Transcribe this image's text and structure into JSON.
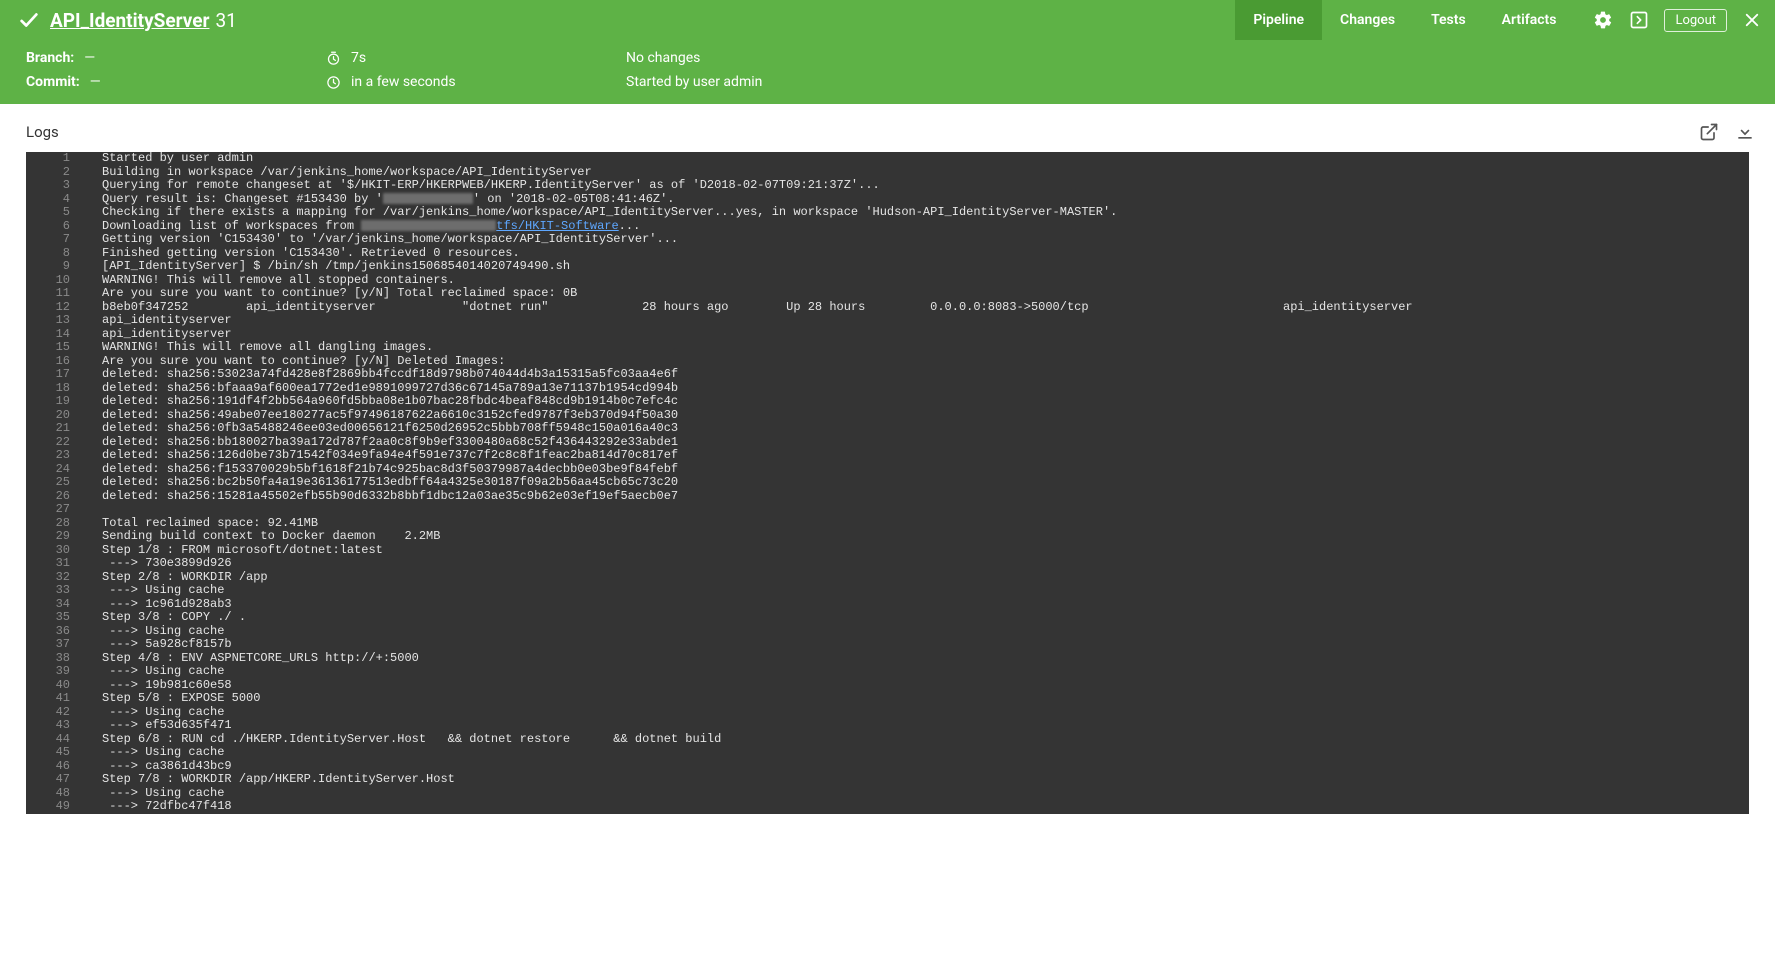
{
  "header": {
    "title_link": "API_IdentityServer",
    "title_number": "31",
    "tabs": [
      {
        "label": "Pipeline",
        "active": true
      },
      {
        "label": "Changes",
        "active": false
      },
      {
        "label": "Tests",
        "active": false
      },
      {
        "label": "Artifacts",
        "active": false
      }
    ],
    "logout_label": "Logout"
  },
  "info": {
    "branch_label": "Branch:",
    "branch_value": "—",
    "commit_label": "Commit:",
    "commit_value": "—",
    "duration": "7s",
    "started": "in a few seconds",
    "changes": "No changes",
    "started_by": "Started by user admin"
  },
  "logs_section": {
    "title": "Logs"
  },
  "log_lines": [
    {
      "n": 1,
      "t": "Started by user admin"
    },
    {
      "n": 2,
      "t": "Building in workspace /var/jenkins_home/workspace/API_IdentityServer"
    },
    {
      "n": 3,
      "t": "Querying for remote changeset at '$/HKIT-ERP/HKERPWEB/HKERP.IdentityServer' as of 'D2018-02-07T09:21:37Z'..."
    },
    {
      "n": 4,
      "segments": [
        {
          "text": "Query result is: Changeset #153430 by '"
        },
        {
          "redact": true
        },
        {
          "text": "' on '2018-02-05T08:41:46Z'."
        }
      ]
    },
    {
      "n": 5,
      "t": "Checking if there exists a mapping for /var/jenkins_home/workspace/API_IdentityServer...yes, in workspace 'Hudson-API_IdentityServer-MASTER'."
    },
    {
      "n": 6,
      "segments": [
        {
          "text": "Downloading list of workspaces from "
        },
        {
          "redact": true,
          "wide": true
        },
        {
          "text": "tfs/HKIT-Software",
          "link": true
        },
        {
          "text": "..."
        }
      ]
    },
    {
      "n": 7,
      "t": "Getting version 'C153430' to '/var/jenkins_home/workspace/API_IdentityServer'..."
    },
    {
      "n": 8,
      "t": "Finished getting version 'C153430'. Retrieved 0 resources."
    },
    {
      "n": 9,
      "t": "[API_IdentityServer] $ /bin/sh /tmp/jenkins1506854014020749490.sh"
    },
    {
      "n": 10,
      "t": "WARNING! This will remove all stopped containers."
    },
    {
      "n": 11,
      "t": "Are you sure you want to continue? [y/N] Total reclaimed space: 0B"
    },
    {
      "n": 12,
      "t": "b8eb0f347252        api_identityserver            \"dotnet run\"             28 hours ago        Up 28 hours         0.0.0.0:8083->5000/tcp                           api_identityserver"
    },
    {
      "n": 13,
      "t": "api_identityserver"
    },
    {
      "n": 14,
      "t": "api_identityserver"
    },
    {
      "n": 15,
      "t": "WARNING! This will remove all dangling images."
    },
    {
      "n": 16,
      "t": "Are you sure you want to continue? [y/N] Deleted Images:"
    },
    {
      "n": 17,
      "t": "deleted: sha256:53023a74fd428e8f2869bb4fccdf18d9798b074044d4b3a15315a5fc03aa4e6f"
    },
    {
      "n": 18,
      "t": "deleted: sha256:bfaaa9af600ea1772ed1e9891099727d36c67145a789a13e71137b1954cd994b"
    },
    {
      "n": 19,
      "t": "deleted: sha256:191df4f2bb564a960fd5bba08e1b07bac28fbdc4beaf848cd9b1914b0c7efc4c"
    },
    {
      "n": 20,
      "t": "deleted: sha256:49abe07ee180277ac5f97496187622a6610c3152cfed9787f3eb370d94f50a30"
    },
    {
      "n": 21,
      "t": "deleted: sha256:0fb3a5488246ee03ed00656121f6250d26952c5bbb708ff5948c150a016a40c3"
    },
    {
      "n": 22,
      "t": "deleted: sha256:bb180027ba39a172d787f2aa0c8f9b9ef3300480a68c52f436443292e33abde1"
    },
    {
      "n": 23,
      "t": "deleted: sha256:126d0be73b71542f034e9fa94e4f591e737c7f2c8c8f1feac2ba814d70c817ef"
    },
    {
      "n": 24,
      "t": "deleted: sha256:f153370029b5bf1618f21b74c925bac8d3f50379987a4decbb0e03be9f84febf"
    },
    {
      "n": 25,
      "t": "deleted: sha256:bc2b50fa4a19e36136177513edbff64a4325e30187f09a2b56aa45cb65c73c20"
    },
    {
      "n": 26,
      "t": "deleted: sha256:15281a45502efb55b90d6332b8bbf1dbc12a03ae35c9b62e03ef19ef5aecb0e7"
    },
    {
      "n": 27,
      "t": ""
    },
    {
      "n": 28,
      "t": "Total reclaimed space: 92.41MB"
    },
    {
      "n": 29,
      "t": "Sending build context to Docker daemon    2.2MB"
    },
    {
      "n": 30,
      "t": "Step 1/8 : FROM microsoft/dotnet:latest"
    },
    {
      "n": 31,
      "t": " ---> 730e3899d926"
    },
    {
      "n": 32,
      "t": "Step 2/8 : WORKDIR /app"
    },
    {
      "n": 33,
      "t": " ---> Using cache"
    },
    {
      "n": 34,
      "t": " ---> 1c961d928ab3"
    },
    {
      "n": 35,
      "t": "Step 3/8 : COPY ./ ."
    },
    {
      "n": 36,
      "t": " ---> Using cache"
    },
    {
      "n": 37,
      "t": " ---> 5a928cf8157b"
    },
    {
      "n": 38,
      "t": "Step 4/8 : ENV ASPNETCORE_URLS http://+:5000"
    },
    {
      "n": 39,
      "t": " ---> Using cache"
    },
    {
      "n": 40,
      "t": " ---> 19b981c60e58"
    },
    {
      "n": 41,
      "t": "Step 5/8 : EXPOSE 5000"
    },
    {
      "n": 42,
      "t": " ---> Using cache"
    },
    {
      "n": 43,
      "t": " ---> ef53d635f471"
    },
    {
      "n": 44,
      "t": "Step 6/8 : RUN cd ./HKERP.IdentityServer.Host   && dotnet restore      && dotnet build"
    },
    {
      "n": 45,
      "t": " ---> Using cache"
    },
    {
      "n": 46,
      "t": " ---> ca3861d43bc9"
    },
    {
      "n": 47,
      "t": "Step 7/8 : WORKDIR /app/HKERP.IdentityServer.Host"
    },
    {
      "n": 48,
      "t": " ---> Using cache"
    },
    {
      "n": 49,
      "t": " ---> 72dfbc47f418"
    }
  ]
}
